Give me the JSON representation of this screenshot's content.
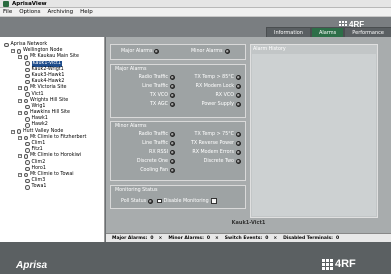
{
  "window": {
    "title": "AprisaView"
  },
  "menu": [
    "File",
    "Options",
    "Archiving",
    "Help"
  ],
  "tabs": [
    {
      "label": "Information",
      "active": false
    },
    {
      "label": "Alarms",
      "active": true
    },
    {
      "label": "Performance",
      "active": false
    }
  ],
  "brand": {
    "top_logo": "4RF",
    "bottom_product": "Aprisa",
    "bottom_logo": "4RF"
  },
  "tree": [
    {
      "label": "Aprisa Network",
      "level": 0,
      "expander": "",
      "selected": false
    },
    {
      "label": "Wellington Node",
      "level": 1,
      "expander": "−",
      "selected": false
    },
    {
      "label": "Mt Kaukau Main Site",
      "level": 2,
      "expander": "−",
      "selected": false
    },
    {
      "label": "Kauk1-Vict1",
      "level": 3,
      "expander": "",
      "selected": true
    },
    {
      "label": "Kauk2-Wrigt1",
      "level": 3,
      "expander": "",
      "selected": false
    },
    {
      "label": "Kauk3-Hawk1",
      "level": 3,
      "expander": "",
      "selected": false
    },
    {
      "label": "Kauk4-Hawk2",
      "level": 3,
      "expander": "",
      "selected": false
    },
    {
      "label": "Mt Victoria Site",
      "level": 2,
      "expander": "−",
      "selected": false
    },
    {
      "label": "Vict1",
      "level": 3,
      "expander": "",
      "selected": false
    },
    {
      "label": "Wrights Hill Site",
      "level": 2,
      "expander": "−",
      "selected": false
    },
    {
      "label": "Wrig1",
      "level": 3,
      "expander": "",
      "selected": false
    },
    {
      "label": "Hawkins Hill Site",
      "level": 2,
      "expander": "−",
      "selected": false
    },
    {
      "label": "Hawk1",
      "level": 3,
      "expander": "",
      "selected": false
    },
    {
      "label": "Hawk2",
      "level": 3,
      "expander": "",
      "selected": false
    },
    {
      "label": "Hutt Valley Node",
      "level": 1,
      "expander": "−",
      "selected": false
    },
    {
      "label": "Mt Climie to Fitzherbert",
      "level": 2,
      "expander": "−",
      "selected": false
    },
    {
      "label": "Clim1",
      "level": 3,
      "expander": "",
      "selected": false
    },
    {
      "label": "Fitz1",
      "level": 3,
      "expander": "",
      "selected": false
    },
    {
      "label": "Mt Climie to Horokiwi",
      "level": 2,
      "expander": "−",
      "selected": false
    },
    {
      "label": "Clim2",
      "level": 3,
      "expander": "",
      "selected": false
    },
    {
      "label": "Horo1",
      "level": 3,
      "expander": "",
      "selected": false
    },
    {
      "label": "Mt Climie to Towai",
      "level": 2,
      "expander": "−",
      "selected": false
    },
    {
      "label": "Clim3",
      "level": 3,
      "expander": "",
      "selected": false
    },
    {
      "label": "Towa1",
      "level": 3,
      "expander": "",
      "selected": false
    }
  ],
  "summary": {
    "major": "Major Alarms",
    "minor": "Minor Alarms"
  },
  "major_alarms": {
    "title": "Major Alarms",
    "rows": [
      [
        "Radio Traffic",
        "TX Temp > 85°C"
      ],
      [
        "Line Traffic",
        "RX Modem Lock"
      ],
      [
        "TX VCO",
        "RX VCO"
      ],
      [
        "TX AGC",
        "Power Supply"
      ]
    ]
  },
  "minor_alarms": {
    "title": "Minor Alarms",
    "rows": [
      [
        "Radio Traffic",
        "TX Temp > 75°C"
      ],
      [
        "Line Traffic",
        "TX Reverse Power"
      ],
      [
        "RX RSSI",
        "RX Modem Errors"
      ],
      [
        "Discrete One",
        "Discrete Two"
      ],
      [
        "Cooling Fan",
        ""
      ]
    ]
  },
  "monitoring": {
    "title": "Monitoring Status",
    "poll_label": "Poll Status",
    "disable_label": "Disable Monitoring",
    "button_label": "W"
  },
  "history": {
    "title": "Alarm History"
  },
  "selected_node": "Kauk1-Vict1",
  "statusbar": [
    {
      "label": "Major Alarms:",
      "value": "0"
    },
    {
      "label": "Minor Alarms:",
      "value": "0"
    },
    {
      "label": "Switch Events:",
      "value": "0"
    },
    {
      "label": "Disabled Terminals:",
      "value": "0"
    }
  ],
  "statusbar_separator": "×"
}
